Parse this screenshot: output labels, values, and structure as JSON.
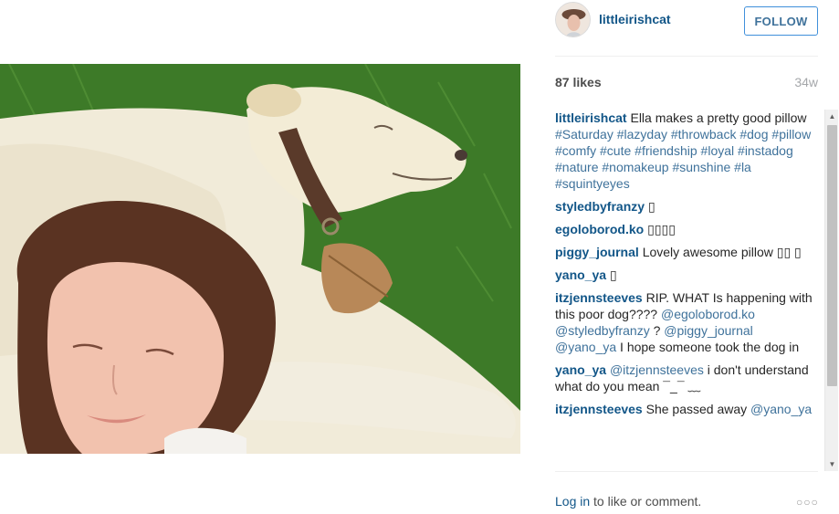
{
  "post": {
    "username": "littleirishcat",
    "follow_label": "FOLLOW",
    "likes": "87 likes",
    "time": "34w"
  },
  "caption": {
    "author": "littleirishcat",
    "text": "Ella makes a pretty good pillow",
    "hashtags": [
      "#Saturday",
      "#lazyday",
      "#throwback",
      "#dog",
      "#pillow",
      "#comfy",
      "#cute",
      "#friendship",
      "#loyal",
      "#instadog",
      "#nature",
      "#nomakeup",
      "#sunshine",
      "#la",
      "#squintyeyes"
    ]
  },
  "comments": [
    {
      "author": "styledbyfranzy",
      "parts": [
        {
          "t": "text",
          "v": "▯"
        }
      ]
    },
    {
      "author": "egoloborod.ko",
      "parts": [
        {
          "t": "text",
          "v": "▯▯▯▯"
        }
      ]
    },
    {
      "author": "piggy_journal",
      "parts": [
        {
          "t": "text",
          "v": "Lovely awesome pillow ▯▯ ▯"
        }
      ]
    },
    {
      "author": "yano_ya",
      "parts": [
        {
          "t": "text",
          "v": "▯"
        }
      ]
    },
    {
      "author": "itzjennsteeves",
      "parts": [
        {
          "t": "text",
          "v": "RIP. WHAT Is happening with this poor dog???? "
        },
        {
          "t": "tag",
          "v": "@egoloborod.ko"
        },
        {
          "t": "text",
          "v": " "
        },
        {
          "t": "tag",
          "v": "@styledbyfranzy"
        },
        {
          "t": "text",
          "v": " ? "
        },
        {
          "t": "tag",
          "v": "@piggy_journal"
        },
        {
          "t": "text",
          "v": " "
        },
        {
          "t": "tag",
          "v": "@yano_ya"
        },
        {
          "t": "text",
          "v": " I hope someone took the dog in"
        }
      ]
    },
    {
      "author": "yano_ya",
      "parts": [
        {
          "t": "tag",
          "v": "@itzjennsteeves"
        },
        {
          "t": "text",
          "v": " i don't understand what do you mean ¯_¯ ﹏"
        }
      ]
    },
    {
      "author": "itzjennsteeves",
      "parts": [
        {
          "t": "text",
          "v": "She passed away "
        },
        {
          "t": "tag",
          "v": "@yano_ya"
        }
      ]
    }
  ],
  "footer": {
    "login_label": "Log in",
    "rest": " to like or comment.",
    "more_label": "○○○"
  },
  "scrollbar": {
    "up": "▲",
    "down": "▼"
  },
  "colors": {
    "link": "#125688",
    "tag": "#3f729b",
    "follow_border": "#4090db"
  }
}
